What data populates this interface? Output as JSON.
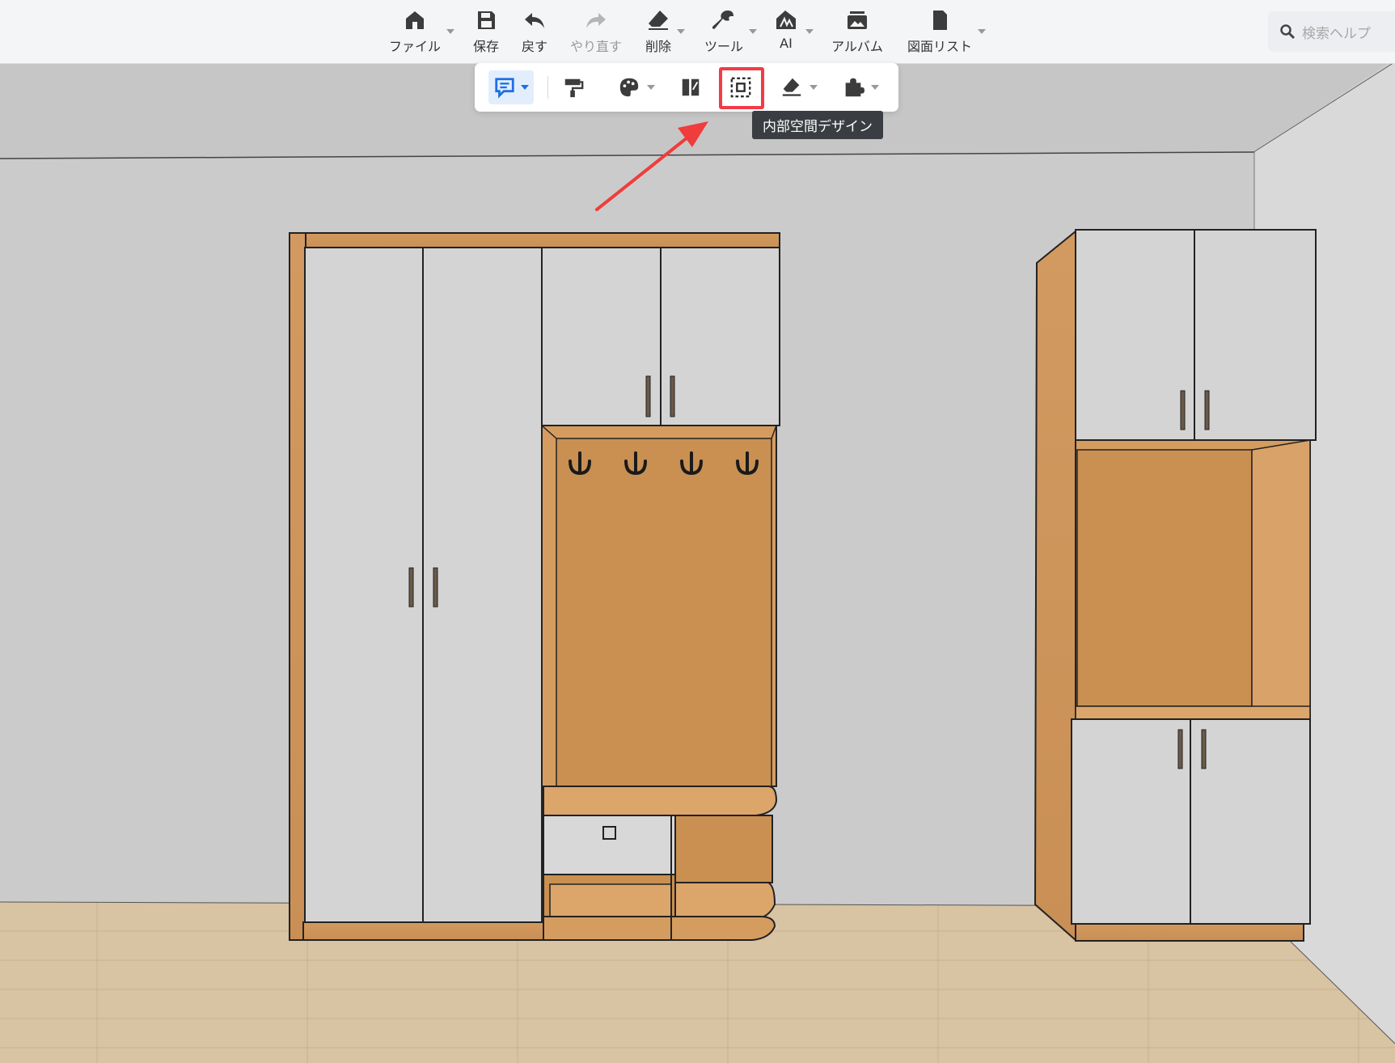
{
  "toolbar": {
    "items": [
      {
        "label": "ファイル",
        "icon": "home-icon",
        "disabled": false,
        "has_menu": true
      },
      {
        "label": "保存",
        "icon": "save-icon",
        "disabled": false,
        "has_menu": false
      },
      {
        "label": "戻す",
        "icon": "undo-icon",
        "disabled": false,
        "has_menu": false
      },
      {
        "label": "やり直す",
        "icon": "redo-icon",
        "disabled": true,
        "has_menu": false
      },
      {
        "label": "削除",
        "icon": "eraser-icon",
        "disabled": false,
        "has_menu": true
      },
      {
        "label": "ツール",
        "icon": "wrench-icon",
        "disabled": false,
        "has_menu": true
      },
      {
        "label": "AI",
        "icon": "ai-icon",
        "disabled": false,
        "has_menu": true
      },
      {
        "label": "アルバム",
        "icon": "album-icon",
        "disabled": false,
        "has_menu": false
      },
      {
        "label": "図面リスト",
        "icon": "document-icon",
        "disabled": false,
        "has_menu": true
      }
    ]
  },
  "search": {
    "placeholder": "検索ヘルプ",
    "icon": "search-icon"
  },
  "subtoolbar": {
    "items": [
      {
        "icon": "board-edit-icon",
        "active": true,
        "has_menu": true
      },
      {
        "icon": "paint-roller-icon",
        "active": false,
        "has_menu": false
      },
      {
        "icon": "palette-icon",
        "active": false,
        "has_menu": true
      },
      {
        "icon": "door-panel-icon",
        "active": false,
        "has_menu": false
      },
      {
        "icon": "interior-space-icon",
        "active": false,
        "highlighted": true,
        "has_menu": false
      },
      {
        "icon": "edge-banding-icon",
        "active": false,
        "has_menu": true
      },
      {
        "icon": "plugin-icon",
        "active": false,
        "has_menu": true
      }
    ]
  },
  "tooltip": {
    "text": "内部空間デザイン"
  },
  "colors": {
    "accent": "#1e6fe6",
    "highlight": "#f23b45",
    "wood": "#d49a5e",
    "door": "#d5d5d5",
    "wall": "#cbcbcb",
    "floor": "#d9c3a2"
  }
}
